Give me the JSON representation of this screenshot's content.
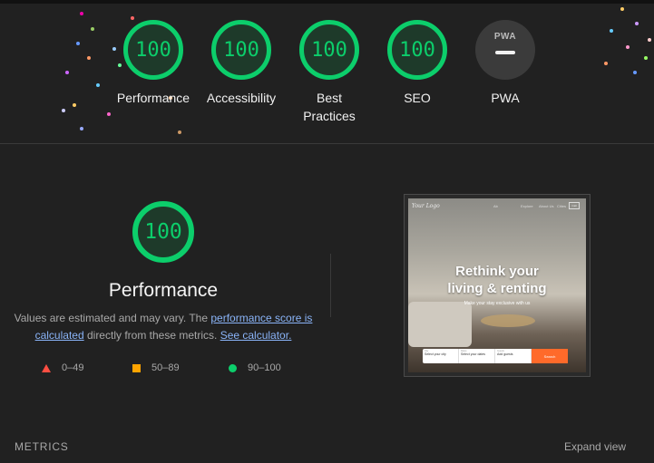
{
  "categories": [
    {
      "score": "100",
      "label": "Performance"
    },
    {
      "score": "100",
      "label": "Accessibility"
    },
    {
      "score": "100",
      "label": "Best Practices"
    },
    {
      "score": "100",
      "label": "SEO"
    }
  ],
  "pwa": {
    "badge": "PWA",
    "label": "PWA"
  },
  "performance": {
    "score": "100",
    "title": "Performance",
    "desc_prefix": "Values are estimated and may vary. The ",
    "link_score": "performance score is calculated",
    "desc_middle": " directly from these metrics. ",
    "link_calc": "See calculator."
  },
  "legend": [
    {
      "range": "0–49",
      "color": "#ff4e42"
    },
    {
      "range": "50–89",
      "color": "#ffa400"
    },
    {
      "range": "90–100",
      "color": "#0cce6b"
    }
  ],
  "screenshot": {
    "logo": "Your Logo",
    "nav": [
      "Ab",
      "Explore",
      "About Us",
      "Cities",
      "Call"
    ],
    "hero_line1": "Rethink your",
    "hero_line2": "living & renting",
    "hero_sub": "Make your stay exclusive with us",
    "fields": [
      {
        "label": "City",
        "value": "Select your city"
      },
      {
        "label": "Dates",
        "value": "Select your dates"
      },
      {
        "label": "Guests",
        "value": "Add guests"
      }
    ],
    "search_btn": "Search"
  },
  "footer": {
    "metrics": "METRICS",
    "expand": "Expand view"
  },
  "colors": {
    "pass": "#0cce6b",
    "average": "#ffa400",
    "fail": "#ff4e42",
    "background": "#212121"
  }
}
